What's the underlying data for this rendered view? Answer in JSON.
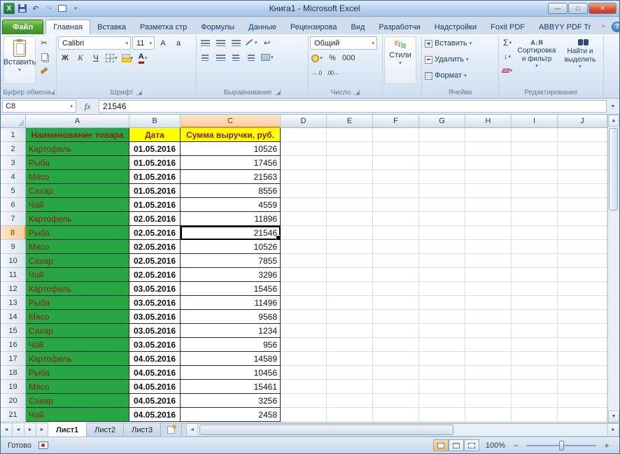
{
  "window": {
    "title": "Книга1  -  Microsoft Excel"
  },
  "glyphs": {
    "dd": "▾",
    "up": "▲",
    "down": "▼",
    "left": "◄",
    "right": "►",
    "undo": "↶",
    "redo": "↷",
    "min": "—",
    "max": "□",
    "close": "×",
    "chevron_up": "^",
    "help": "?",
    "sigma": "Σ",
    "fx": "fx",
    "scissors": "✂",
    "wrap": "↩",
    "letter_A": "А",
    "letter_a": "а",
    "down_arrow": "↓",
    "sort_icon": "А↓Я",
    "minus": "−",
    "plus": "+",
    "x": "X"
  },
  "ribbon_tabs": [
    {
      "label": "Файл",
      "file": true
    },
    {
      "label": "Главная",
      "active": true
    },
    {
      "label": "Вставка"
    },
    {
      "label": "Разметка стр"
    },
    {
      "label": "Формулы"
    },
    {
      "label": "Данные"
    },
    {
      "label": "Рецензирова"
    },
    {
      "label": "Вид"
    },
    {
      "label": "Разработчи"
    },
    {
      "label": "Надстройки"
    },
    {
      "label": "Foxit PDF"
    },
    {
      "label": "ABBYY PDF Tr"
    }
  ],
  "ribbon": {
    "clipboard": {
      "paste": "Вставить",
      "label": "Буфер обмена"
    },
    "font": {
      "name": "Calibri",
      "size": "11",
      "bold": "Ж",
      "italic": "К",
      "underline": "Ч",
      "label": "Шрифт"
    },
    "alignment": {
      "label": "Выравнивание"
    },
    "number": {
      "format": "Общий",
      "percent": "%",
      "thousands": "000",
      "inc_decimal": "←.0",
      "dec_decimal": ".00→",
      "label": "Число"
    },
    "styles": {
      "button": "Стили"
    },
    "cells": {
      "insert": "Вставить",
      "delete": "Удалить",
      "format": "Формат",
      "label": "Ячейки"
    },
    "editing": {
      "sort": "Сортировка и фильтр",
      "find": "Найти и выделить",
      "label": "Редактирование"
    }
  },
  "formula_bar": {
    "cell_ref": "C8",
    "value": "21546"
  },
  "sheet": {
    "columns": [
      "A",
      "B",
      "C",
      "D",
      "E",
      "F",
      "G",
      "H",
      "I",
      "J"
    ],
    "selected": {
      "col": "C",
      "row": 8
    },
    "header_row": {
      "a": "Наименование товара",
      "b": "Дата",
      "c": "Сумма выручки, руб."
    },
    "rows": [
      [
        "Картофель",
        "01.05.2016",
        "10526"
      ],
      [
        "Рыба",
        "01.05.2016",
        "17456"
      ],
      [
        "Мясо",
        "01.05.2016",
        "21563"
      ],
      [
        "Сахар",
        "01.05.2016",
        "8556"
      ],
      [
        "Чай",
        "01.05.2016",
        "4559"
      ],
      [
        "Картофель",
        "02.05.2016",
        "11896"
      ],
      [
        "Рыба",
        "02.05.2016",
        "21546"
      ],
      [
        "Мясо",
        "02.05.2016",
        "10526"
      ],
      [
        "Сахар",
        "02.05.2016",
        "7855"
      ],
      [
        "Чай",
        "02.05.2016",
        "3296"
      ],
      [
        "Картофель",
        "03.05.2016",
        "15456"
      ],
      [
        "Рыба",
        "03.05.2016",
        "11496"
      ],
      [
        "Мясо",
        "03.05.2016",
        "9568"
      ],
      [
        "Сахар",
        "03.05.2016",
        "1234"
      ],
      [
        "Чай",
        "03.05.2016",
        "956"
      ],
      [
        "Картофель",
        "04.05.2016",
        "14589"
      ],
      [
        "Рыба",
        "04.05.2016",
        "10456"
      ],
      [
        "Мясо",
        "04.05.2016",
        "15461"
      ],
      [
        "Сахар",
        "04.05.2016",
        "3256"
      ],
      [
        "Чай",
        "04.05.2016",
        "2458"
      ]
    ]
  },
  "sheet_tabs": [
    {
      "label": "Лист1",
      "active": true
    },
    {
      "label": "Лист2",
      "active": false
    },
    {
      "label": "Лист3",
      "active": false
    }
  ],
  "status_bar": {
    "ready": "Готово",
    "zoom": "100%"
  },
  "colors": {
    "green_fill": "#27A744",
    "yellow_fill": "#FFFF00",
    "dark_red_text": "#8B2012",
    "file_tab_green": "#4E9B2E",
    "selection_border": "#000000",
    "header_highlight": "#F8CDA0"
  }
}
